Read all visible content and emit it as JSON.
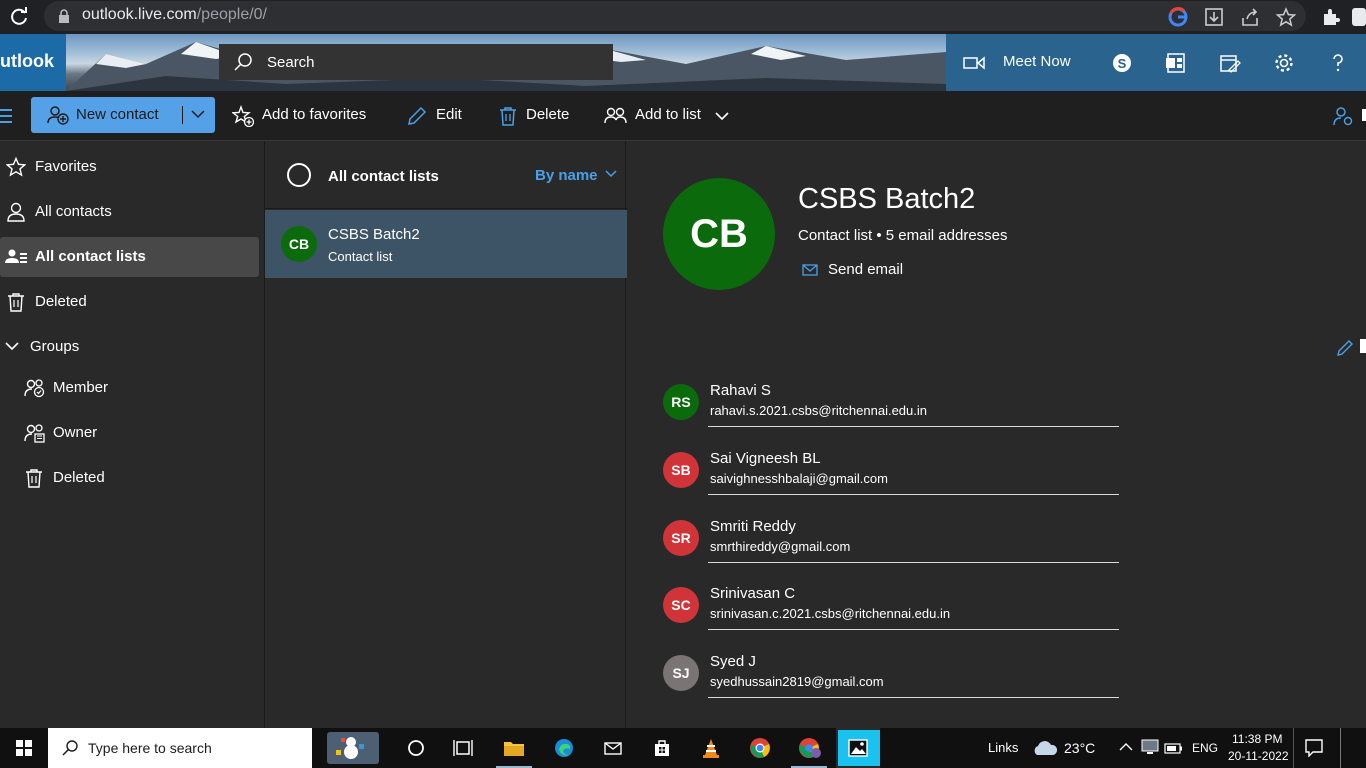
{
  "browser": {
    "url_host": "outlook.live.com",
    "url_path": "/people/0/"
  },
  "header": {
    "brand": "utlook",
    "search_placeholder": "Search",
    "meet_now": "Meet Now"
  },
  "toolbar": {
    "new_contact": "New contact",
    "add_to_favorites": "Add to favorites",
    "edit": "Edit",
    "delete": "Delete",
    "add_to_list": "Add to list"
  },
  "nav": {
    "favorites": "Favorites",
    "all_contacts": "All contacts",
    "all_contact_lists": "All contact lists",
    "deleted": "Deleted",
    "groups": "Groups",
    "member": "Member",
    "owner": "Owner",
    "groups_deleted": "Deleted"
  },
  "list": {
    "title": "All contact lists",
    "sort": "By name",
    "items": [
      {
        "initials": "CB",
        "name": "CSBS Batch2",
        "type": "Contact list"
      }
    ]
  },
  "detail": {
    "initials": "CB",
    "name": "CSBS Batch2",
    "subtitle": "Contact list • 5 email addresses",
    "send_email": "Send email",
    "members": [
      {
        "initials": "RS",
        "name": "Rahavi S",
        "email": "rahavi.s.2021.csbs@ritchennai.edu.in",
        "color": "#0b6a0b"
      },
      {
        "initials": "SB",
        "name": "Sai Vigneesh BL",
        "email": "saivighnesshbalaji@gmail.com",
        "color": "#d13438"
      },
      {
        "initials": "SR",
        "name": "Smriti Reddy",
        "email": "smrthireddy@gmail.com",
        "color": "#d13438"
      },
      {
        "initials": "SC",
        "name": "Srinivasan C",
        "email": "srinivasan.c.2021.csbs@ritchennai.edu.in",
        "color": "#d13438"
      },
      {
        "initials": "SJ",
        "name": "Syed J",
        "email": "syedhussain2819@gmail.com",
        "color": "#7a7574"
      }
    ]
  },
  "taskbar": {
    "search_placeholder": "Type here to search",
    "links": "Links",
    "temperature": "23°C",
    "language": "ENG",
    "time": "11:38 PM",
    "date": "20-11-2022"
  },
  "colors": {
    "accent": "#55a1e8",
    "selected_item": "#3d5466",
    "avatar_green": "#0b6a0b"
  }
}
